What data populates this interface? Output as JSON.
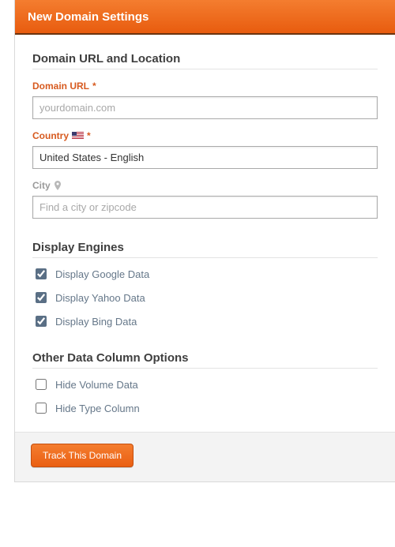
{
  "header": {
    "title": "New Domain Settings"
  },
  "section1": {
    "title": "Domain URL and Location",
    "domain_label": "Domain URL",
    "domain_placeholder": "yourdomain.com",
    "domain_value": "",
    "country_label": "Country",
    "country_value": "United States - English",
    "city_label": "City",
    "city_placeholder": "Find a city or zipcode",
    "city_value": ""
  },
  "section2": {
    "title": "Display Engines",
    "items": [
      {
        "label": "Display Google Data",
        "checked": true
      },
      {
        "label": "Display Yahoo Data",
        "checked": true
      },
      {
        "label": "Display Bing Data",
        "checked": true
      }
    ]
  },
  "section3": {
    "title": "Other Data Column Options",
    "items": [
      {
        "label": "Hide Volume Data",
        "checked": false
      },
      {
        "label": "Hide Type Column",
        "checked": false
      }
    ]
  },
  "footer": {
    "submit_label": "Track This Domain"
  },
  "req": "*"
}
